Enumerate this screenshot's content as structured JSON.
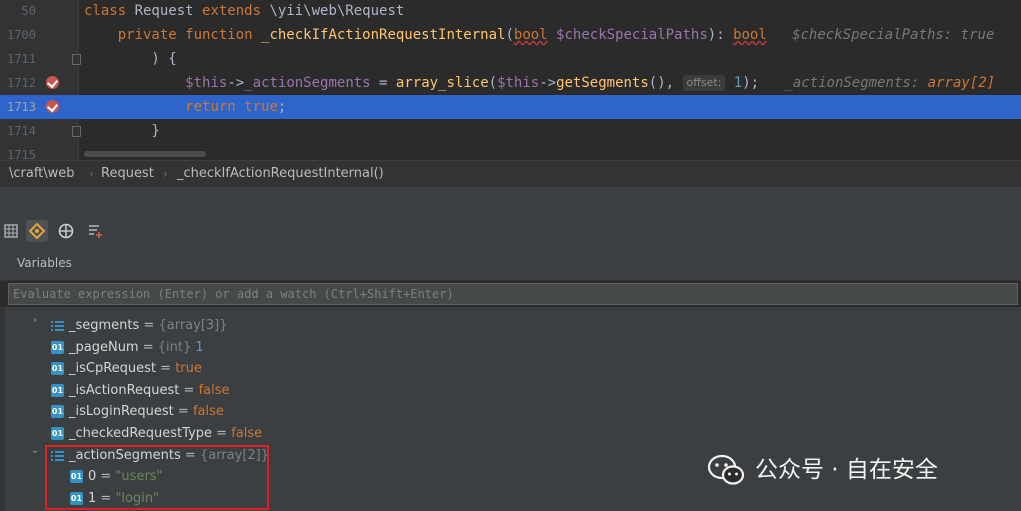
{
  "editor": {
    "lines": [
      {
        "num": "50",
        "parts": [
          [
            "kw",
            "class "
          ],
          [
            "plain",
            "Request "
          ],
          [
            "kw",
            "extends "
          ],
          [
            "plain",
            "\\yii\\web\\Request"
          ]
        ]
      },
      {
        "num": "1700",
        "parts": [
          [
            "plain",
            "    "
          ],
          [
            "kw",
            "private function "
          ],
          [
            "fn",
            "_checkIfActionRequestInternal"
          ],
          [
            "plain",
            "("
          ],
          [
            "kw squig",
            "bool"
          ],
          [
            "plain",
            " "
          ],
          [
            "var",
            "$checkSpecialPaths"
          ],
          [
            "plain",
            "): "
          ],
          [
            "kw squig",
            "bool"
          ],
          [
            "plain",
            "   "
          ],
          [
            "hint",
            "$checkSpecialPaths: true"
          ]
        ]
      },
      {
        "num": "1711",
        "parts": [
          [
            "plain",
            "        ) {"
          ]
        ]
      },
      {
        "num": "1712",
        "parts": [
          [
            "plain",
            "            "
          ],
          [
            "var",
            "$this"
          ],
          [
            "plain",
            "->"
          ],
          [
            "var",
            "_actionSegments"
          ],
          [
            "plain",
            " = "
          ],
          [
            "fn",
            "array_slice"
          ],
          [
            "plain",
            "("
          ],
          [
            "var",
            "$this"
          ],
          [
            "plain",
            "->"
          ],
          [
            "fn",
            "getSegments"
          ],
          [
            "plain",
            "(), "
          ],
          [
            "inlay",
            "offset:"
          ],
          [
            "plain",
            " "
          ],
          [
            "num",
            "1"
          ],
          [
            "plain",
            ");   "
          ],
          [
            "hint",
            "_actionSegments: "
          ],
          [
            "hint-val",
            "array[2]"
          ]
        ]
      },
      {
        "num": "1713",
        "parts": [
          [
            "plain",
            "            "
          ],
          [
            "kw",
            "return true"
          ],
          [
            "plain",
            ";"
          ]
        ]
      },
      {
        "num": "1714",
        "parts": [
          [
            "plain",
            "        }"
          ]
        ]
      },
      {
        "num": "1715",
        "parts": []
      }
    ]
  },
  "breadcrumb": {
    "items": [
      "\\craft\\web",
      "Request",
      "_checkIfActionRequestInternal()"
    ],
    "separator": "›"
  },
  "toolbar": {
    "icons": [
      "table-icon",
      "watch-diamond-icon",
      "globe-icon",
      "add-list-icon"
    ]
  },
  "variables": {
    "title": "Variables",
    "eval_placeholder": "Evaluate expression (Enter) or add a watch (Ctrl+Shift+Enter)",
    "rows": [
      {
        "name": "_segments",
        "eq": " = ",
        "type": "{array[3]}",
        "value": "",
        "vclass": "vnum",
        "icon": "array",
        "expander": "›",
        "indent": 0
      },
      {
        "name": "_pageNum",
        "eq": " = ",
        "type": "{int} ",
        "value": "1",
        "vclass": "vnum",
        "icon": "prim",
        "expander": "",
        "indent": 0
      },
      {
        "name": "_isCpRequest",
        "eq": " = ",
        "type": "",
        "value": "true",
        "vclass": "vkw",
        "icon": "prim",
        "expander": "",
        "indent": 0
      },
      {
        "name": "_isActionRequest",
        "eq": " = ",
        "type": "",
        "value": "false",
        "vclass": "vkw",
        "icon": "prim",
        "expander": "",
        "indent": 0
      },
      {
        "name": "_isLoginRequest",
        "eq": " = ",
        "type": "",
        "value": "false",
        "vclass": "vkw",
        "icon": "prim",
        "expander": "",
        "indent": 0
      },
      {
        "name": "_checkedRequestType",
        "eq": " = ",
        "type": "",
        "value": "false",
        "vclass": "vkw",
        "icon": "prim",
        "expander": "",
        "indent": 0
      },
      {
        "name": "_actionSegments",
        "eq": " = ",
        "type": "{array[2]}",
        "value": "",
        "vclass": "vnum",
        "icon": "array",
        "expander": "⌄",
        "indent": 0
      },
      {
        "name": "0",
        "eq": " = ",
        "type": "",
        "value": "\"users\"",
        "vclass": "vstr",
        "icon": "prim",
        "expander": "",
        "indent": 1
      },
      {
        "name": "1",
        "eq": " = ",
        "type": "",
        "value": "\"login\"",
        "vclass": "vstr",
        "icon": "prim",
        "expander": "",
        "indent": 1
      }
    ],
    "prim_icon_label": "01"
  },
  "watermark": {
    "text": "公众号 · 自在安全"
  },
  "colors": {
    "current_line": "#2f65ca",
    "breakpoint": "#c75450",
    "highlight_box": "#e02020"
  }
}
